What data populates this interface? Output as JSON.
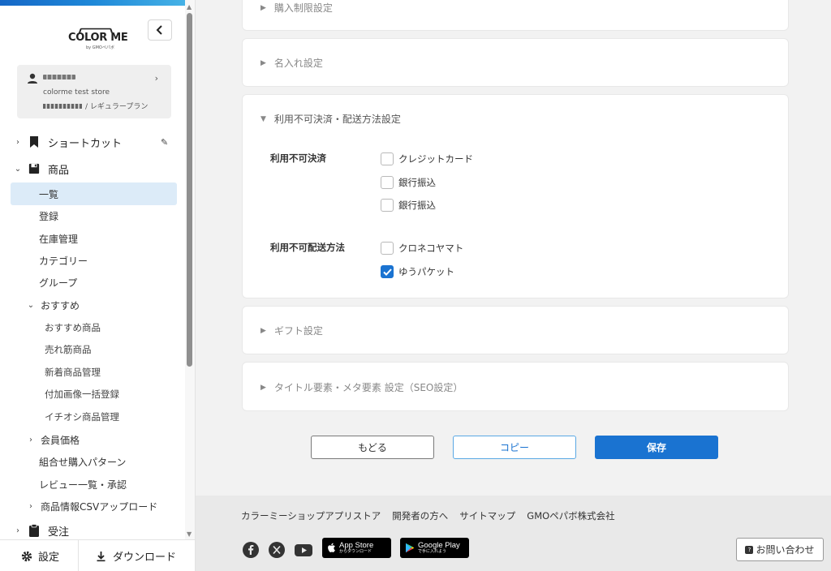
{
  "brand": {
    "logo_text": "COLOR ME",
    "logo_sub": "by GMOペパボ"
  },
  "account": {
    "store_name": "colorme test store",
    "plan": "/ レギュラープラン"
  },
  "nav": {
    "shortcut": "ショートカット",
    "products": "商品",
    "products_items": {
      "list": "一覧",
      "register": "登録",
      "stock": "在庫管理",
      "category": "カテゴリー",
      "group": "グループ",
      "recommend": "おすすめ",
      "recommend_items": {
        "recommended": "おすすめ商品",
        "bestseller": "売れ筋商品",
        "new_items": "新着商品管理",
        "bulk_images": "付加画像一括登録",
        "featured": "イチオシ商品管理"
      },
      "member_price": "会員価格",
      "combo": "組合せ購入パターン",
      "reviews": "レビュー一覧・承認",
      "csv": "商品情報CSVアップロード"
    },
    "orders": "受注"
  },
  "sidebar_footer": {
    "settings": "設定",
    "download": "ダウンロード"
  },
  "panels": {
    "purchase_limit": "購入制限設定",
    "engraving": "名入れ設定",
    "unavailable": {
      "title": "利用不可決済・配送方法設定",
      "payment_label": "利用不可決済",
      "payment_options": [
        {
          "label": "クレジットカード",
          "checked": false
        },
        {
          "label": "銀行振込",
          "checked": false
        },
        {
          "label": "銀行振込",
          "checked": false
        }
      ],
      "shipping_label": "利用不可配送方法",
      "shipping_options": [
        {
          "label": "クロネコヤマト",
          "checked": false
        },
        {
          "label": "ゆうパケット",
          "checked": true
        }
      ]
    },
    "gift": "ギフト設定",
    "seo": "タイトル要素・メタ要素 設定（SEO設定）"
  },
  "buttons": {
    "back": "もどる",
    "copy": "コピー",
    "save": "保存"
  },
  "footer": {
    "links": [
      "カラーミーショップアプリストア",
      "開発者の方へ",
      "サイトマップ",
      "GMOペパボ株式会社"
    ],
    "appstore": {
      "big": "App Store",
      "small": "からダウンロード"
    },
    "googleplay": {
      "big": "Google Play",
      "small": "で手に入れよう"
    },
    "contact": "お問い合わせ"
  },
  "colors": {
    "accent": "#1a73d1",
    "active_bg": "#dcebf8",
    "topbar": "#1e88d8"
  }
}
